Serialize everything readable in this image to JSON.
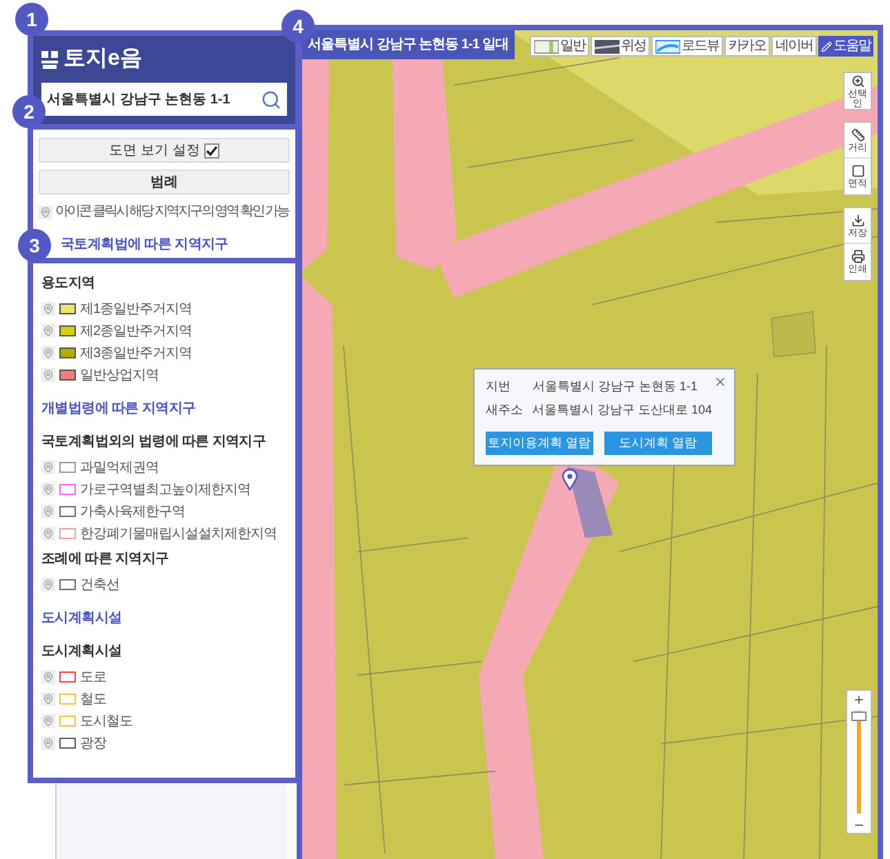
{
  "badges": [
    "1",
    "2",
    "3",
    "4"
  ],
  "header": {
    "logo": "토지e음",
    "search": {
      "value": "서울특별시 강남구 논현동 1-1"
    }
  },
  "settings": {
    "view_toggle": {
      "label": "도면 보기 설정",
      "checked": true
    },
    "legend_button": "범례",
    "hint": "아이콘 클릭시 해당 지역지구의 영역 확인 가능",
    "heading": "국토계획법에 따른 지역지구"
  },
  "legend": [
    {
      "kind": "subheading",
      "label": "용도지역"
    },
    {
      "kind": "filled",
      "label": "제1종일반주거지역",
      "color": "#ece46a"
    },
    {
      "kind": "filled",
      "label": "제2종일반주거지역",
      "color": "#d6cf0e"
    },
    {
      "kind": "filled",
      "label": "제3종일반주거지역",
      "color": "#b3ac00"
    },
    {
      "kind": "filled",
      "label": "일반상업지역",
      "color": "#ef7f7f"
    },
    {
      "kind": "heading",
      "label": "개별법령에 따른 지역지구"
    },
    {
      "kind": "subheading",
      "label": "국토계획법외의 법령에 따른 지역지구"
    },
    {
      "kind": "outline",
      "label": "과밀억제권역",
      "color": "#9a9a9a"
    },
    {
      "kind": "outline",
      "label": "가로구역별최고높이제한지역",
      "color": "#ff66ff"
    },
    {
      "kind": "outline",
      "label": "가축사육제한구역",
      "color": "#707070"
    },
    {
      "kind": "outline",
      "label": "한강폐기물매립시설설치제한지역",
      "color": "#f2a0a8"
    },
    {
      "kind": "subheading",
      "label": "조례에 따른 지역지구"
    },
    {
      "kind": "outline",
      "label": "건축선",
      "color": "#707070"
    },
    {
      "kind": "heading",
      "label": "도시계획시설"
    },
    {
      "kind": "subheading",
      "label": "도시계획시설"
    },
    {
      "kind": "outline",
      "label": "도로",
      "color": "#ff4040"
    },
    {
      "kind": "outline",
      "label": "철도",
      "color": "#ffc040"
    },
    {
      "kind": "outline",
      "label": "도시철도",
      "color": "#ffc040"
    },
    {
      "kind": "outline",
      "label": "광장",
      "color": "#606060"
    }
  ],
  "map": {
    "title": "서울특별시 강남구 논현동 1-1 일대",
    "layers": [
      {
        "kind": "map",
        "label": "일반"
      },
      {
        "kind": "satellite",
        "label": "위성"
      },
      {
        "kind": "roadview",
        "label": "로드뷰"
      },
      {
        "kind": "text",
        "label": "카카오"
      },
      {
        "kind": "text",
        "label": "네이버"
      }
    ],
    "help": "도움말",
    "tools": [
      [
        {
          "kind": "zoom",
          "label": "선택인"
        }
      ],
      [
        {
          "kind": "distance",
          "label": "거리"
        },
        {
          "kind": "area",
          "label": "면적"
        }
      ],
      [
        {
          "kind": "download",
          "label": "저장"
        },
        {
          "kind": "print",
          "label": "인쇄"
        }
      ]
    ],
    "zoom": {
      "level": 0.95
    },
    "popup": {
      "rows": [
        {
          "label": "지번",
          "value": "서울특별시 강남구 논현동 1-1"
        },
        {
          "label": "새주소",
          "value": "서울특별시 강남구 도산대로 104"
        }
      ],
      "buttons": [
        "토지이용계획 열람",
        "도시계획 열람"
      ]
    }
  }
}
